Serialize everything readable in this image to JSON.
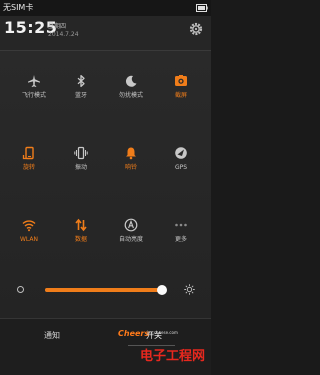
{
  "status_bar": {
    "carrier": "无SIM卡"
  },
  "header": {
    "time": "15:25",
    "weekday": "星期四",
    "date": "2014.7.24"
  },
  "toggles": [
    {
      "label": "飞行模式",
      "icon": "airplane-icon",
      "active": false
    },
    {
      "label": "蓝牙",
      "icon": "bluetooth-icon",
      "active": false
    },
    {
      "label": "勿扰模式",
      "icon": "moon-icon",
      "active": false
    },
    {
      "label": "截屏",
      "icon": "screenshot-icon",
      "active": true
    },
    {
      "label": "旋转",
      "icon": "rotate-icon",
      "active": true
    },
    {
      "label": "振动",
      "icon": "vibrate-icon",
      "active": false
    },
    {
      "label": "响铃",
      "icon": "bell-icon",
      "active": true
    },
    {
      "label": "GPS",
      "icon": "gps-icon",
      "active": false
    },
    {
      "label": "WLAN",
      "icon": "wifi-icon",
      "active": true
    },
    {
      "label": "数据",
      "icon": "data-icon",
      "active": true
    },
    {
      "label": "自动亮度",
      "icon": "auto-brightness-icon",
      "active": false
    },
    {
      "label": "更多",
      "icon": "more-icon",
      "active": false
    }
  ],
  "brightness": {
    "level": 0.97
  },
  "tabs": {
    "notify": "通知",
    "switch": "开关"
  },
  "watermark": {
    "logo": "Cheers",
    "url": "jxs.cheese.com",
    "title": "电子工程网"
  },
  "colors": {
    "accent": "#f07d1a",
    "inactive": "#c8c8c8",
    "background": "#262626"
  }
}
